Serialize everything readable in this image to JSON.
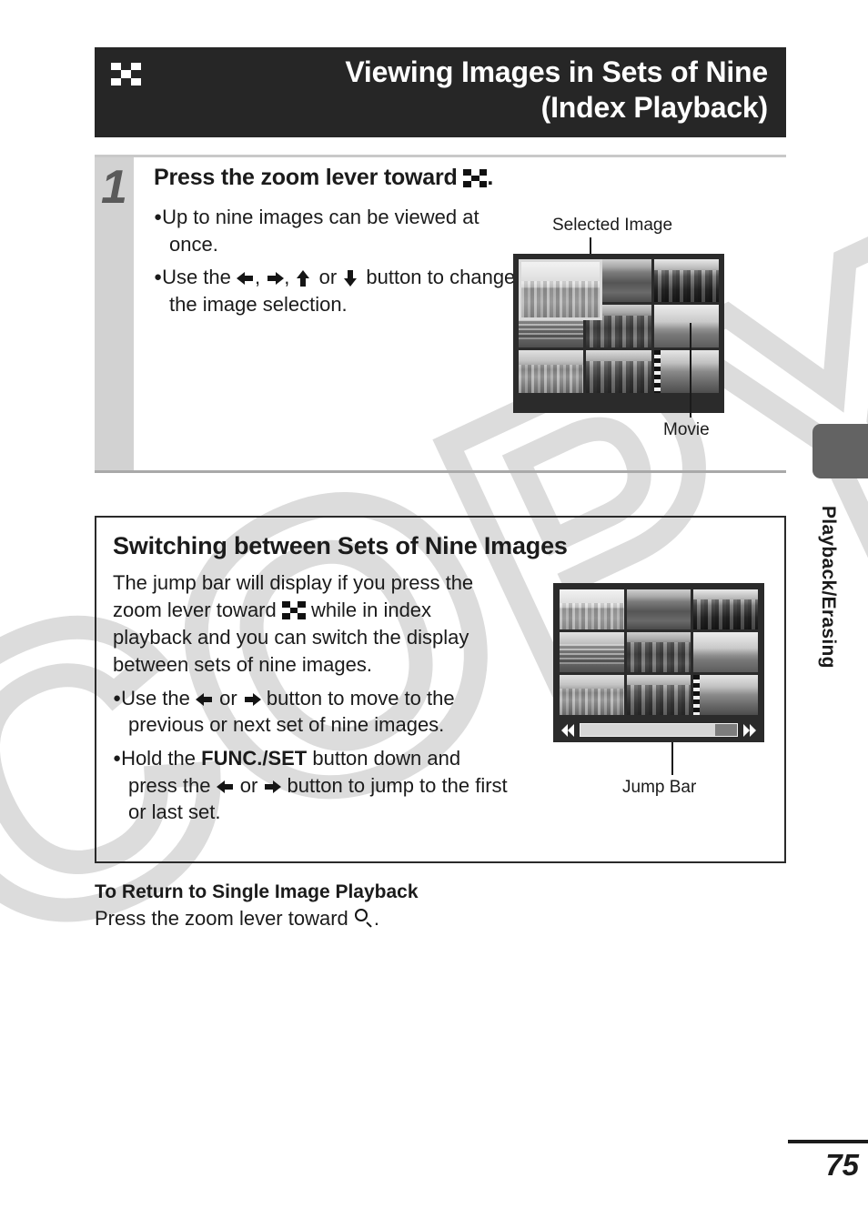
{
  "watermark": {
    "text": "COPY"
  },
  "header": {
    "icon": "index-checkerboard-icon",
    "title_line1": "Viewing Images in Sets of Nine",
    "title_line2": "(Index Playback)"
  },
  "step": {
    "number": "1",
    "heading_before_icon": "Press the zoom lever toward ",
    "heading_icon": "index-checkerboard-icon",
    "heading_after_icon": ".",
    "bullets": [
      {
        "dot": "●",
        "text": "Up to nine images can be viewed at once."
      },
      {
        "dot": "●",
        "part1": "Use the ",
        "icon1": "arrow-left-icon",
        "sep1": ", ",
        "icon2": "arrow-right-icon",
        "sep2": ", ",
        "icon3": "arrow-up-icon",
        "sep3": " or ",
        "icon4": "arrow-down-icon",
        "part2": " button to change the image selection."
      }
    ],
    "screen": {
      "callout_top": "Selected Image",
      "callout_bottom": "Movie",
      "selected_cell": "top-left",
      "movie_cell": "bottom-right",
      "grid_rows": 3,
      "grid_cols": 3
    }
  },
  "section": {
    "title": "Switching between Sets of Nine Images",
    "intro_part1": "The jump bar will display if you press the zoom lever toward ",
    "intro_icon": "index-checkerboard-icon",
    "intro_part2": " while in index playback and you can switch the display between sets of nine images.",
    "bullets": [
      {
        "dot": "●",
        "part1": "Use the ",
        "icon1": "arrow-left-icon",
        "sep1": " or ",
        "icon2": "arrow-right-icon",
        "part2": " button to move to the previous or next set of nine images."
      },
      {
        "dot": "●",
        "part1": "Hold the ",
        "bold": "FUNC./SET",
        "part2": " button down and press the ",
        "icon1": "arrow-left-icon",
        "sep1": " or ",
        "icon2": "arrow-right-icon",
        "part3": " button to jump to the first or last set."
      }
    ],
    "screen": {
      "callout_bottom": "Jump Bar",
      "jump_prev_icon": "double-arrow-left-icon",
      "jump_next_icon": "double-arrow-right-icon",
      "thumb_position_percent": 86
    }
  },
  "return_note": {
    "title": "To Return to Single Image Playback",
    "text_before_icon": "Press the zoom lever toward ",
    "icon": "magnifier-icon",
    "text_after_icon": "."
  },
  "side_tab": {
    "label": "Playback/Erasing"
  },
  "footer": {
    "page_number": "75"
  },
  "colors": {
    "header_bg": "#262626",
    "step_col_bg": "#d2d2d2",
    "lcd_bg": "#2b2b2b",
    "side_tab_bg": "#636363",
    "watermark": "#dcdcdc",
    "text": "#1b1b1b"
  }
}
